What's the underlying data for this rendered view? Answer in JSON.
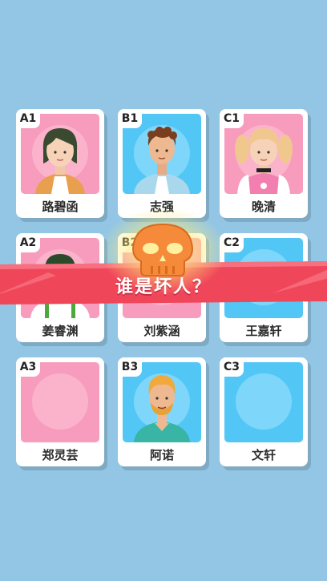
{
  "prompt": {
    "question": "谁是坏人？"
  },
  "colors": {
    "background": "#93c6e4",
    "banner": "#f0465a",
    "pink_card": "#f79cbc",
    "blue_card": "#52c7f6",
    "skull": "#f58a3a"
  },
  "cards": [
    {
      "id": "A1",
      "name": "路碧函",
      "bg": "pink",
      "avatar": "girl-dark-bob"
    },
    {
      "id": "B1",
      "name": "志强",
      "bg": "blue",
      "avatar": "boy-curly-hair"
    },
    {
      "id": "C1",
      "name": "晚清",
      "bg": "pink",
      "avatar": "girl-pigtails"
    },
    {
      "id": "A2",
      "name": "姜睿渊",
      "bg": "pink",
      "avatar": "man-suspenders"
    },
    {
      "id": "B2",
      "name": "刘紫涵",
      "bg": "pink",
      "avatar": "empty"
    },
    {
      "id": "C2",
      "name": "王嘉轩",
      "bg": "blue",
      "avatar": "empty"
    },
    {
      "id": "A3",
      "name": "郑灵芸",
      "bg": "pink",
      "avatar": "empty"
    },
    {
      "id": "B3",
      "name": "阿诺",
      "bg": "blue",
      "avatar": "man-beard"
    },
    {
      "id": "C3",
      "name": "文轩",
      "bg": "blue",
      "avatar": "empty"
    }
  ],
  "icons": {
    "center": "skull-icon"
  }
}
